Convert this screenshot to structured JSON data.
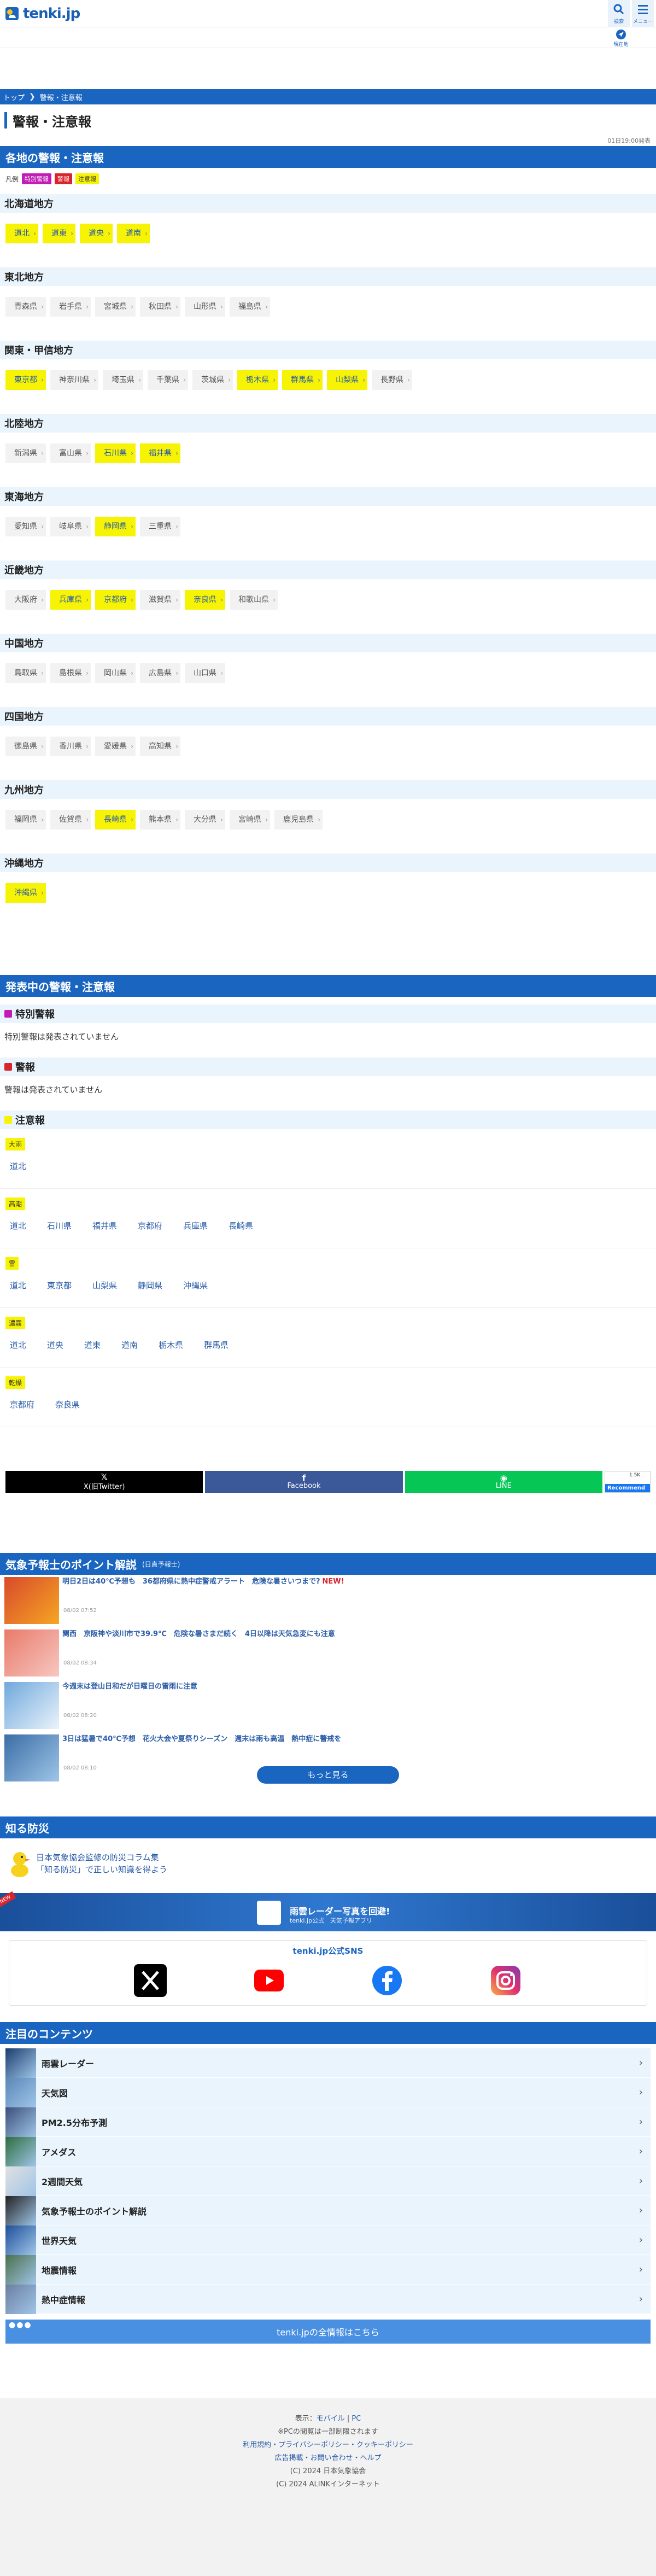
{
  "header": {
    "logo_text": "tenki.jp",
    "search_label": "検索",
    "menu_label": "メニュー",
    "location_label": "現在地"
  },
  "breadcrumb": [
    "トップ",
    "警報・注意報"
  ],
  "page_title": "警報・注意報",
  "updated": "01日19:00発表",
  "regional": {
    "title": "各地の警報・注意報",
    "legend_label": "凡例",
    "legend": [
      "特別警報",
      "警報",
      "注意報"
    ],
    "regions": [
      {
        "name": "北海道地方",
        "prefs": [
          {
            "n": "道北",
            "a": true
          },
          {
            "n": "道東",
            "a": true
          },
          {
            "n": "道央",
            "a": true
          },
          {
            "n": "道南",
            "a": true
          }
        ]
      },
      {
        "name": "東北地方",
        "prefs": [
          {
            "n": "青森県",
            "a": false
          },
          {
            "n": "岩手県",
            "a": false
          },
          {
            "n": "宮城県",
            "a": false
          },
          {
            "n": "秋田県",
            "a": false
          },
          {
            "n": "山形県",
            "a": false
          },
          {
            "n": "福島県",
            "a": false
          }
        ]
      },
      {
        "name": "関東・甲信地方",
        "prefs": [
          {
            "n": "東京都",
            "a": true
          },
          {
            "n": "神奈川県",
            "a": false
          },
          {
            "n": "埼玉県",
            "a": false
          },
          {
            "n": "千葉県",
            "a": false
          },
          {
            "n": "茨城県",
            "a": false
          },
          {
            "n": "栃木県",
            "a": true
          },
          {
            "n": "群馬県",
            "a": true
          },
          {
            "n": "山梨県",
            "a": true
          },
          {
            "n": "長野県",
            "a": false
          }
        ]
      },
      {
        "name": "北陸地方",
        "prefs": [
          {
            "n": "新潟県",
            "a": false
          },
          {
            "n": "富山県",
            "a": false
          },
          {
            "n": "石川県",
            "a": true
          },
          {
            "n": "福井県",
            "a": true
          }
        ]
      },
      {
        "name": "東海地方",
        "prefs": [
          {
            "n": "愛知県",
            "a": false
          },
          {
            "n": "岐阜県",
            "a": false
          },
          {
            "n": "静岡県",
            "a": true
          },
          {
            "n": "三重県",
            "a": false
          }
        ]
      },
      {
        "name": "近畿地方",
        "prefs": [
          {
            "n": "大阪府",
            "a": false
          },
          {
            "n": "兵庫県",
            "a": true
          },
          {
            "n": "京都府",
            "a": true
          },
          {
            "n": "滋賀県",
            "a": false
          },
          {
            "n": "奈良県",
            "a": true
          },
          {
            "n": "和歌山県",
            "a": false
          }
        ]
      },
      {
        "name": "中国地方",
        "prefs": [
          {
            "n": "鳥取県",
            "a": false
          },
          {
            "n": "島根県",
            "a": false
          },
          {
            "n": "岡山県",
            "a": false
          },
          {
            "n": "広島県",
            "a": false
          },
          {
            "n": "山口県",
            "a": false
          }
        ]
      },
      {
        "name": "四国地方",
        "prefs": [
          {
            "n": "徳島県",
            "a": false
          },
          {
            "n": "香川県",
            "a": false
          },
          {
            "n": "愛媛県",
            "a": false
          },
          {
            "n": "高知県",
            "a": false
          }
        ]
      },
      {
        "name": "九州地方",
        "prefs": [
          {
            "n": "福岡県",
            "a": false
          },
          {
            "n": "佐賀県",
            "a": false
          },
          {
            "n": "長崎県",
            "a": true
          },
          {
            "n": "熊本県",
            "a": false
          },
          {
            "n": "大分県",
            "a": false
          },
          {
            "n": "宮崎県",
            "a": false
          },
          {
            "n": "鹿児島県",
            "a": false
          }
        ]
      },
      {
        "name": "沖縄地方",
        "prefs": [
          {
            "n": "沖縄県",
            "a": true
          }
        ]
      }
    ]
  },
  "issued": {
    "title": "発表中の警報・注意報",
    "special_heading": "特別警報",
    "special_none": "特別警報は発表されていません",
    "warning_heading": "警報",
    "warning_none": "警報は発表されていません",
    "advisory_heading": "注意報",
    "advisories": [
      {
        "kind": "大雨",
        "areas": [
          "道北"
        ]
      },
      {
        "kind": "高潮",
        "areas": [
          "道北",
          "石川県",
          "福井県",
          "京都府",
          "兵庫県",
          "長崎県"
        ]
      },
      {
        "kind": "雷",
        "areas": [
          "道北",
          "東京都",
          "山梨県",
          "静岡県",
          "沖縄県"
        ]
      },
      {
        "kind": "濃霧",
        "areas": [
          "道北",
          "道央",
          "道東",
          "道南",
          "栃木県",
          "群馬県"
        ]
      },
      {
        "kind": "乾燥",
        "areas": [
          "京都府",
          "奈良県"
        ]
      }
    ]
  },
  "share": {
    "x_label": "X(旧Twitter)",
    "fb_label": "Facebook",
    "line_label": "LINE",
    "rec_count": "1.5K",
    "rec_label": "Recommend"
  },
  "forecaster": {
    "title": "気象予報士のポイント解説",
    "subtitle": "(日直予報士)",
    "articles": [
      {
        "title": "明日2日は40℃予想も　36都府県に熱中症警戒アラート　危険な暑さいつまで?",
        "new": "NEW!",
        "date": "08/02 07:52"
      },
      {
        "title": "関西　京阪神や淡川市で39.9℃　危険な暑さまだ続く　4日以降は天気急変にも注意",
        "new": "",
        "date": "08/02 08:34"
      },
      {
        "title": "今週末は登山日和だが日曜日の雷雨に注意",
        "new": "",
        "date": "08/02 08:20"
      },
      {
        "title": "3日は猛暑で40℃予想　花火大会や夏祭りシーズン　週末は雨も高温　熱中症に警戒を",
        "new": "",
        "date": "08/02 08:10"
      }
    ],
    "more": "もっと見る"
  },
  "shiru": {
    "title": "知る防災",
    "line1": "日本気象協会監修の防災コラム集",
    "line2": "「知る防災」で正しい知識を得よう"
  },
  "banner": {
    "tag": "NEW",
    "title": "雨雲レーダー写真を回避!",
    "sub": "tenki.jp公式　天気予報アプリ"
  },
  "sns": {
    "title": "tenki.jp公式SNS"
  },
  "featured": {
    "title": "注目のコンテンツ",
    "items": [
      "雨雲レーダー",
      "天気図",
      "PM2.5分布予測",
      "アメダス",
      "2週間天気",
      "気象予報士のポイント解説",
      "世界天気",
      "地震情報",
      "熱中症情報"
    ],
    "all_label": "tenki.jpの全情報はこちら"
  },
  "footer": {
    "display_label": "表示：",
    "mobile": "モバイル",
    "pc": "PC",
    "line1": "※PCの閲覧は一部制限されます",
    "policy": "利用規約・プライバシーポリシー・クッキーポリシー",
    "ads": "広告掲載・お問い合わせ・ヘルプ",
    "copy1": "(C) 2024 日本気象協会",
    "copy2": "(C) 2024 ALINKインターネット"
  },
  "colors": {
    "brand": "#1a65c0",
    "advisory": "#f7f304",
    "warning": "#d8242c",
    "special": "#c21cb7"
  }
}
